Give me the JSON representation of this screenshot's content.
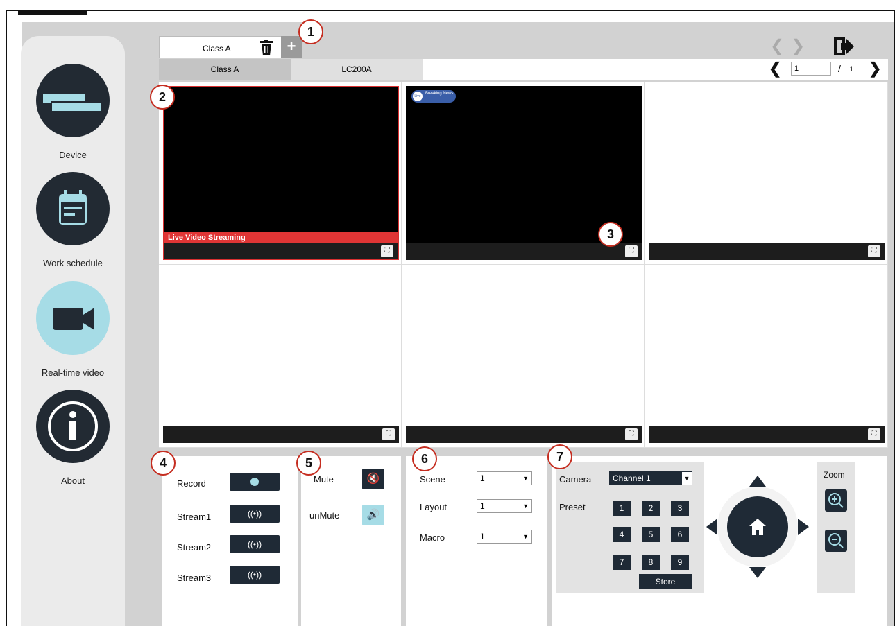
{
  "sidebar": {
    "items": [
      {
        "label": "Device",
        "icon": "device-icon"
      },
      {
        "label": "Work schedule",
        "icon": "calendar-icon"
      },
      {
        "label": "Real-time video",
        "icon": "video-camera-icon",
        "active": true
      },
      {
        "label": "About",
        "icon": "info-icon"
      }
    ]
  },
  "tabs": {
    "current_label": "Class A",
    "add_label": "+"
  },
  "subtabs": [
    "Class A",
    "LC200A"
  ],
  "pager": {
    "current": "1",
    "separator": "/",
    "total": "1"
  },
  "grid": {
    "cells": [
      {
        "banner": "Live Video Streaming",
        "selected": true
      },
      {
        "overlay": "Breaking News"
      },
      {},
      {},
      {},
      {}
    ]
  },
  "callouts": [
    "1",
    "2",
    "3",
    "4",
    "5",
    "6",
    "7"
  ],
  "record_panel": {
    "record_label": "Record",
    "stream1_label": "Stream1",
    "stream2_label": "Stream2",
    "stream3_label": "Stream3",
    "stream_glyph": "((•))"
  },
  "audio_panel": {
    "mute_label": "Mute",
    "unmute_label": "unMute"
  },
  "scene_panel": {
    "scene_label": "Scene",
    "scene_value": "1",
    "layout_label": "Layout",
    "layout_value": "1",
    "macro_label": "Macro",
    "macro_value": "1"
  },
  "ptz_panel": {
    "camera_label": "Camera",
    "camera_value": "Channel 1",
    "preset_label": "Preset",
    "presets": [
      "1",
      "2",
      "3",
      "4",
      "5",
      "6",
      "7",
      "8",
      "9"
    ],
    "store_label": "Store",
    "zoom_label": "Zoom"
  },
  "colors": {
    "dark": "#1f2a36",
    "accent": "#a6dce6",
    "selected_border": "#d93030",
    "callout_border": "#c52d20"
  }
}
